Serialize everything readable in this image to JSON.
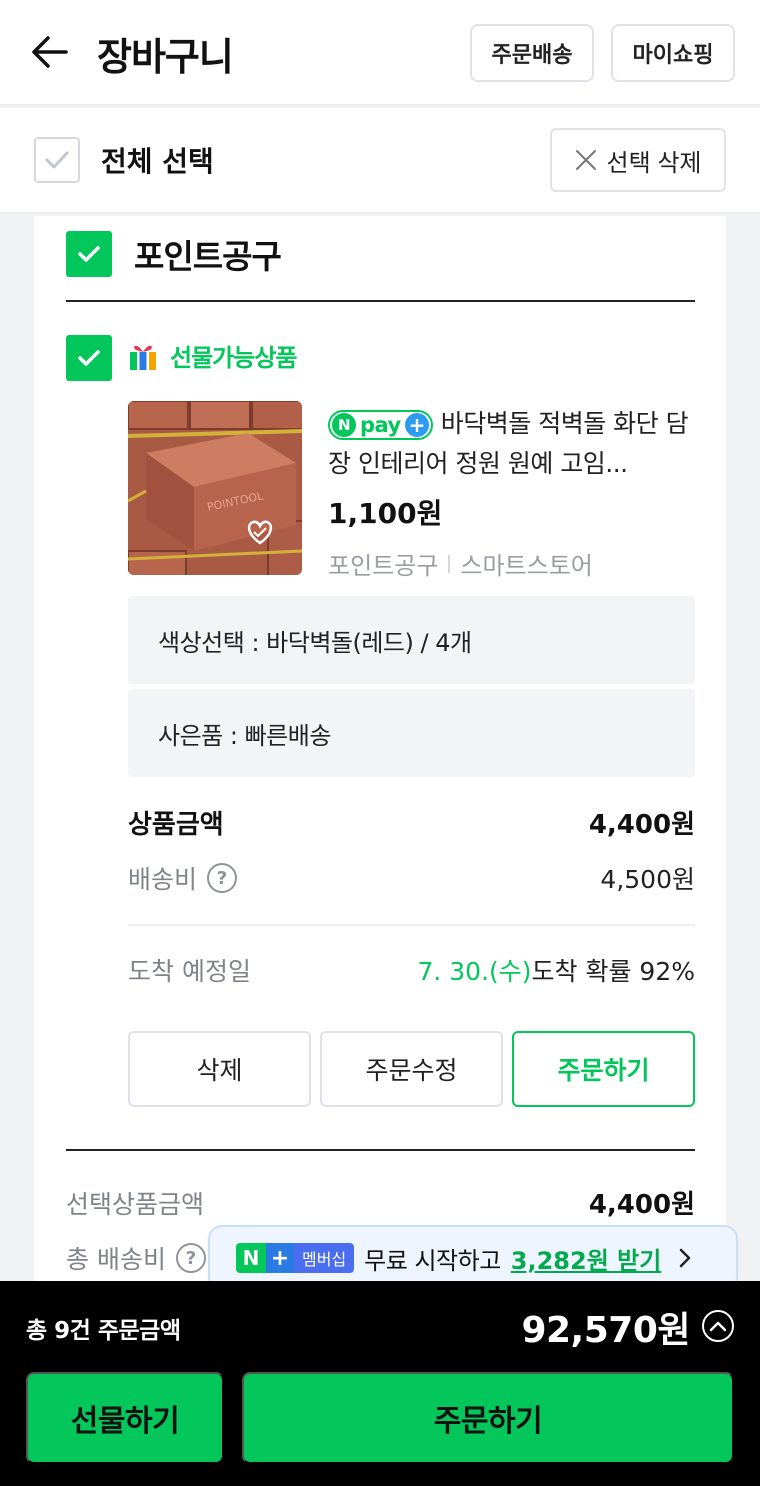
{
  "header": {
    "title": "장바구니",
    "order_delivery_label": "주문배송",
    "my_shopping_label": "마이쇼핑"
  },
  "select_bar": {
    "select_all_label": "전체 선택",
    "delete_selected_label": "선택 삭제"
  },
  "store": {
    "name": "포인트공구",
    "gift_label": "선물가능상품",
    "product": {
      "badge_text": "pay",
      "name": "바닥벽돌 적벽돌 화단 담장 인테리어 정원 원예 고임...",
      "price": "1,100원",
      "seller": "포인트공구",
      "seller_type": "스마트스토어",
      "options": [
        "색상선택 : 바닥벽돌(레드) / 4개",
        "사은품 : 빠른배송"
      ]
    },
    "summary": {
      "product_amount_label": "상품금액",
      "product_amount": "4,400원",
      "shipping_label": "배송비",
      "shipping_amount": "4,500원",
      "arrival_label": "도착 예정일",
      "arrival_date": "7. 30.(수)",
      "arrival_prob": "도착 확률 92%"
    },
    "actions": {
      "delete": "삭제",
      "edit_order": "주문수정",
      "order": "주문하기"
    },
    "totals": {
      "selected_amount_label": "선택상품금액",
      "selected_amount": "4,400원",
      "total_shipping_label": "총 배송비"
    }
  },
  "promo": {
    "membership_tag": "멤버십",
    "text": "무료 시작하고",
    "link": "3,282원 받기"
  },
  "bottom_bar": {
    "count_label": "총 9건 주문금액",
    "total": "92,570원",
    "gift_button": "선물하기",
    "order_button": "주문하기"
  },
  "colors": {
    "accent_green": "#03c75a",
    "promo_bg": "#eef5fe",
    "bottom_bg": "#000000"
  }
}
